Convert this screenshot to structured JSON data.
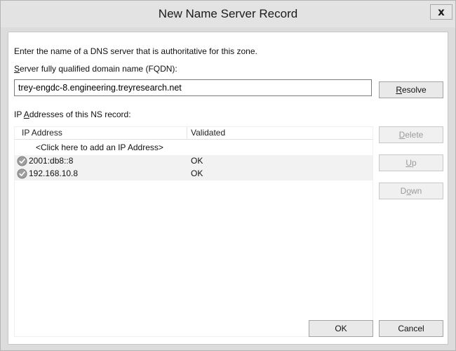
{
  "window": {
    "title": "New Name Server Record",
    "close_label": "x"
  },
  "intro_text": "Enter the name of a DNS server that is authoritative for this zone.",
  "fqdn": {
    "label_accel": "S",
    "label_rest": "erver fully qualified domain name (FQDN):",
    "value": "trey-engdc-8.engineering.treyresearch.net"
  },
  "buttons": {
    "resolve_accel": "R",
    "resolve_rest": "esolve",
    "delete_accel": "D",
    "delete_rest": "elete",
    "up_accel": "U",
    "up_rest": "p",
    "down_pre": "D",
    "down_accel": "o",
    "down_rest": "wn",
    "ok": "OK",
    "cancel": "Cancel"
  },
  "ip_section": {
    "label_pre": "IP ",
    "label_accel": "A",
    "label_rest": "ddresses of this NS record:",
    "columns": [
      "IP Address",
      "Validated"
    ],
    "add_prompt": "<Click here to add an IP Address>",
    "rows": [
      {
        "ip": "2001:db8::8",
        "validated": "OK",
        "icon": "check-circle-icon"
      },
      {
        "ip": "192.168.10.8",
        "validated": "OK",
        "icon": "check-circle-icon"
      }
    ]
  },
  "colors": {
    "window_bg": "#dcdcdc",
    "client_bg": "#ffffff",
    "row_highlight": "#f2f2f2",
    "disabled_text": "#9b9b9b"
  }
}
